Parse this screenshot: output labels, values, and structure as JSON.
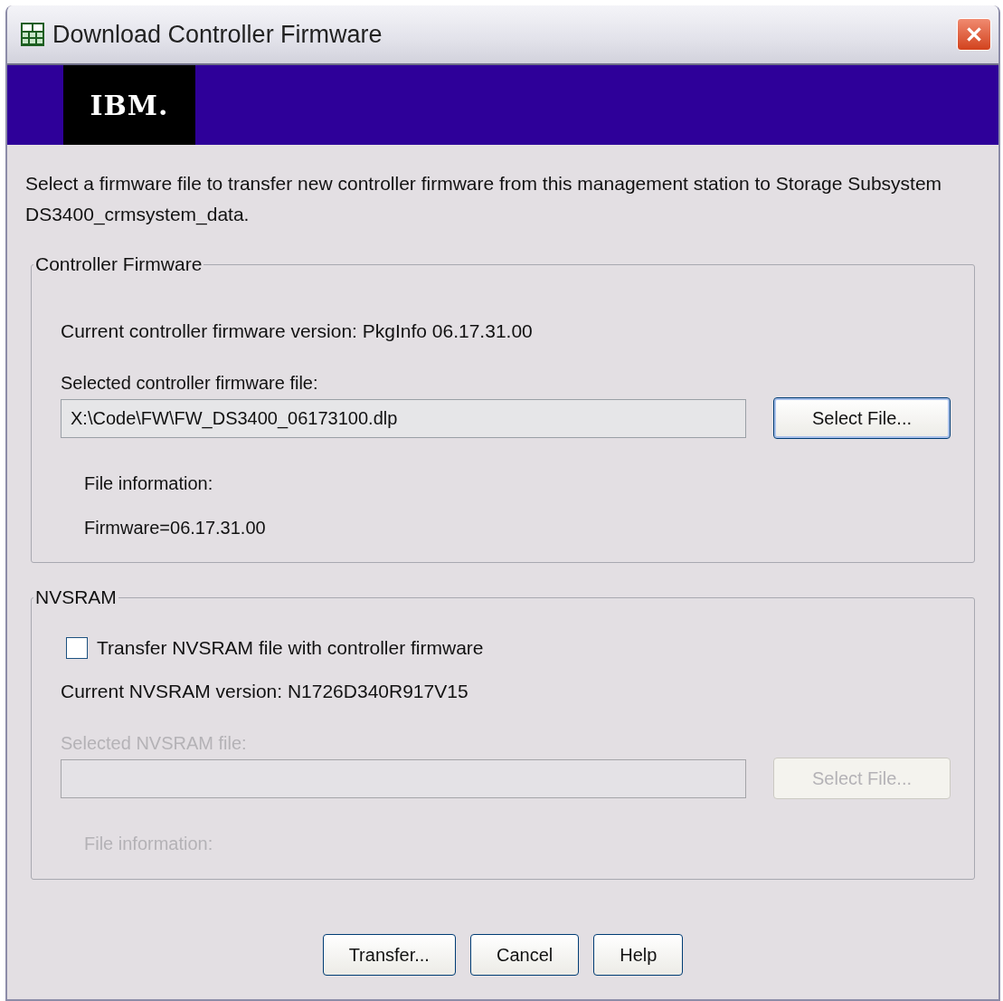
{
  "window": {
    "title": "Download Controller Firmware"
  },
  "banner": {
    "logo": "IBM."
  },
  "intro": "Select a firmware file to transfer new controller firmware from this management station to Storage Subsystem DS3400_crmsystem_data.",
  "controller_firmware": {
    "title": "Controller Firmware",
    "current_version": "Current controller firmware version: PkgInfo 06.17.31.00",
    "file": {
      "label": "Selected controller firmware file:",
      "value": "X:\\Code\\FW\\FW_DS3400_06173100.dlp",
      "disabled": false
    },
    "select_button": {
      "label": "Select File...",
      "disabled": false
    },
    "info": {
      "label": "File information:",
      "lines": [
        "Firmware=06.17.31.00"
      ],
      "disabled": false
    }
  },
  "nvsram": {
    "title": "NVSRAM",
    "transfer_checkbox": {
      "label": "Transfer NVSRAM file with controller firmware",
      "checked": false
    },
    "current_version": "Current NVSRAM version: N1726D340R917V15",
    "file": {
      "label": "Selected NVSRAM file:",
      "disabled": true
    },
    "select_button": {
      "label": "Select File...",
      "disabled": true
    },
    "info": {
      "label": "File information:",
      "disabled": true
    }
  },
  "buttons": [
    "Transfer...",
    "Cancel",
    "Help"
  ]
}
